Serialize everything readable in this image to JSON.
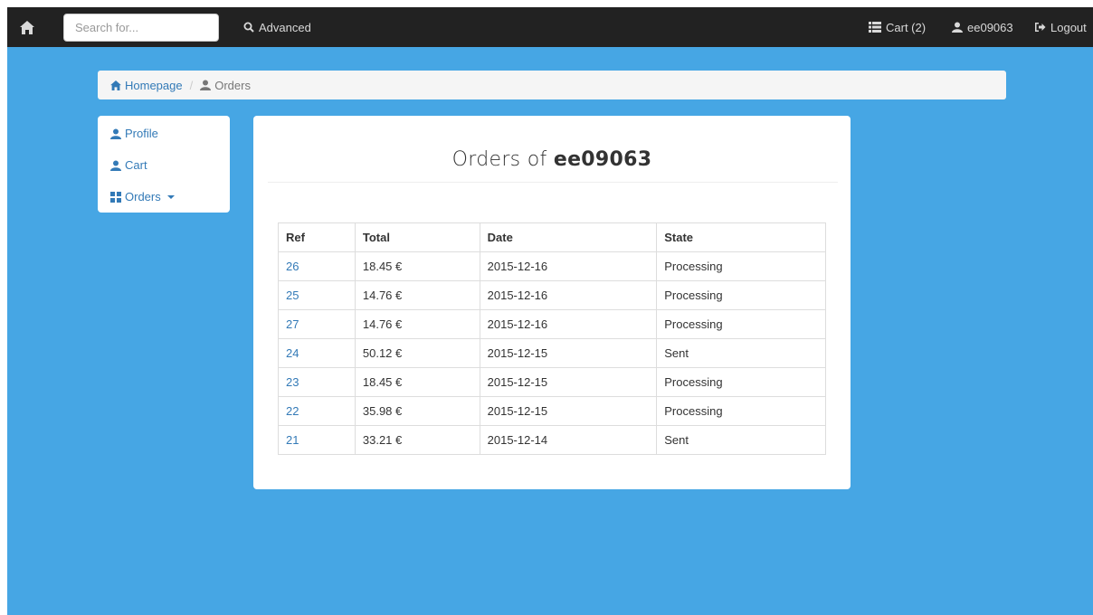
{
  "navbar": {
    "search_placeholder": "Search for...",
    "advanced_label": "Advanced",
    "cart_label": "Cart (2)",
    "user_label": "ee09063",
    "logout_label": "Logout"
  },
  "breadcrumb": {
    "home_label": "Homepage",
    "separator": "/",
    "current_label": "Orders"
  },
  "sidebar": {
    "profile_label": "Profile",
    "cart_label": "Cart",
    "orders_label": "Orders"
  },
  "main": {
    "title_prefix": "Orders of",
    "title_user": "ee09063",
    "table": {
      "headers": [
        "Ref",
        "Total",
        "Date",
        "State"
      ],
      "rows": [
        {
          "ref": "26",
          "total": "18.45 €",
          "date": "2015-12-16",
          "state": "Processing"
        },
        {
          "ref": "25",
          "total": "14.76 €",
          "date": "2015-12-16",
          "state": "Processing"
        },
        {
          "ref": "27",
          "total": "14.76 €",
          "date": "2015-12-16",
          "state": "Processing"
        },
        {
          "ref": "24",
          "total": "50.12 €",
          "date": "2015-12-15",
          "state": "Sent"
        },
        {
          "ref": "23",
          "total": "18.45 €",
          "date": "2015-12-15",
          "state": "Processing"
        },
        {
          "ref": "22",
          "total": "35.98 €",
          "date": "2015-12-15",
          "state": "Processing"
        },
        {
          "ref": "21",
          "total": "33.21 €",
          "date": "2015-12-14",
          "state": "Sent"
        }
      ]
    }
  },
  "colors": {
    "background": "#46a6e4",
    "navbar": "#222222",
    "link": "#337ab7"
  }
}
